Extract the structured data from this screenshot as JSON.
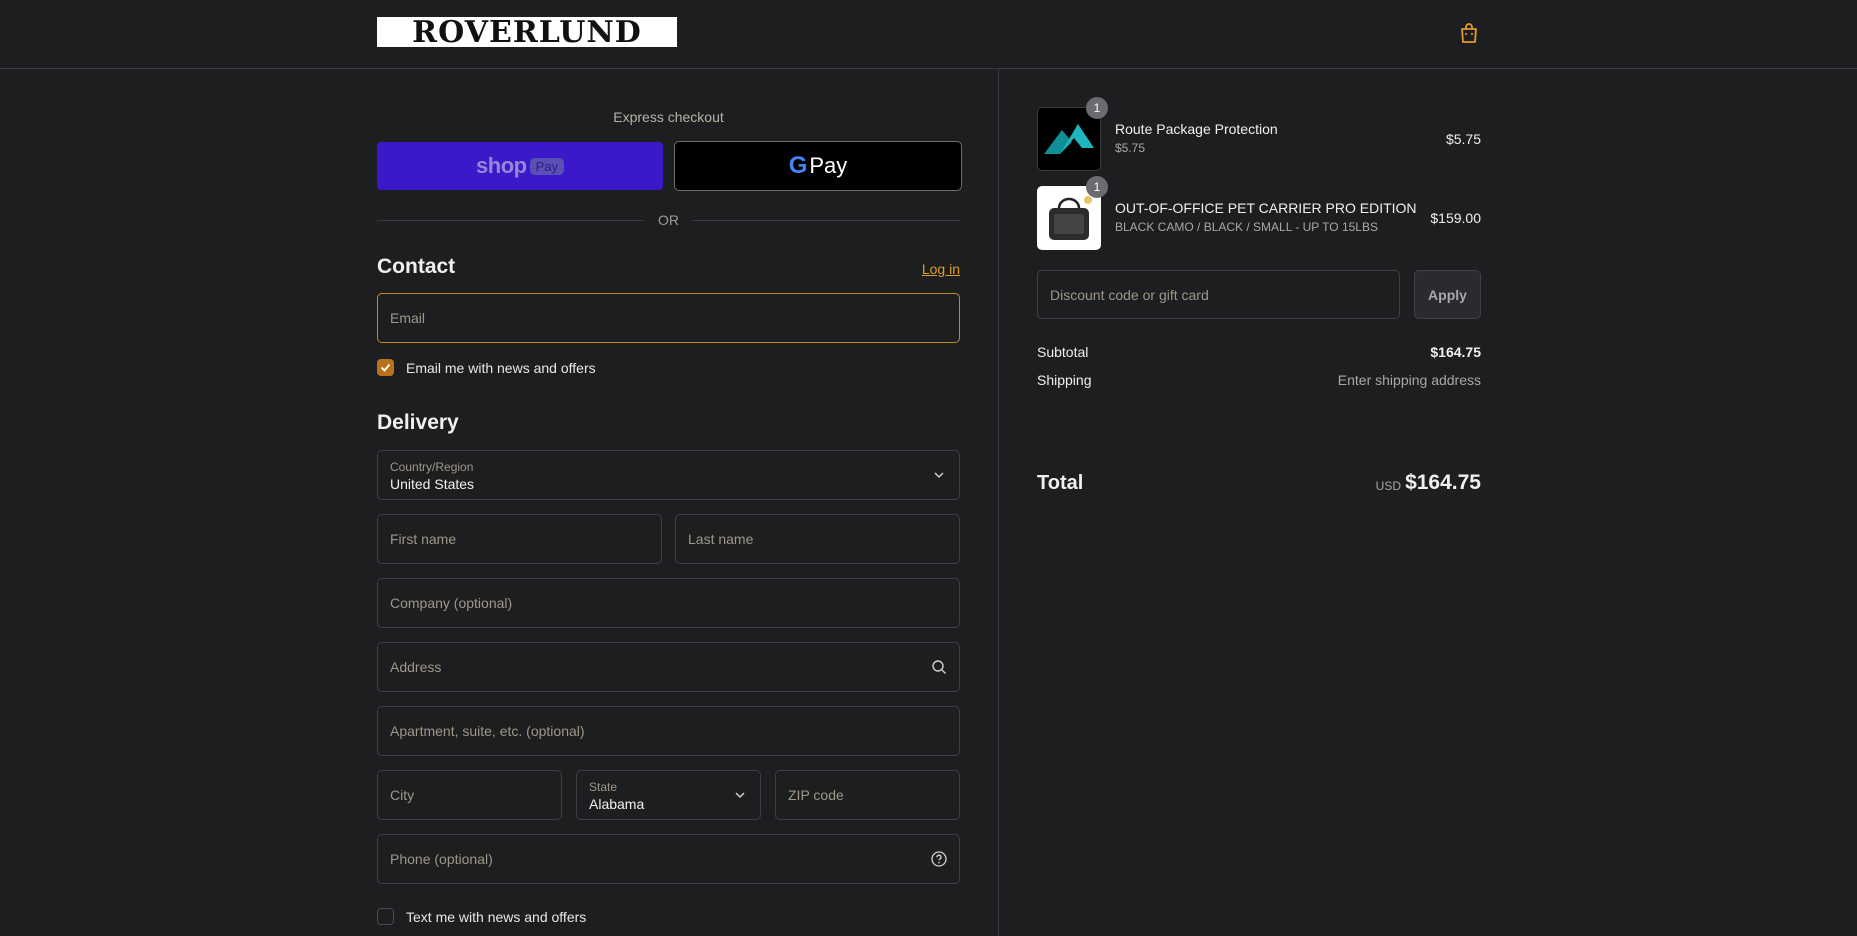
{
  "brand": {
    "logo_text": "ROVERLUND"
  },
  "header": {
    "cart_icon": "shopping-bag-icon"
  },
  "express": {
    "title": "Express checkout",
    "shop_pay_label": "shop",
    "shop_pay_pill": "Pay",
    "gpay_g": "G",
    "gpay_label": "Pay",
    "or_label": "OR"
  },
  "contact": {
    "heading": "Contact",
    "login_label": "Log in",
    "email_placeholder": "Email",
    "news_label": "Email me with news and offers",
    "news_checked": true
  },
  "delivery": {
    "heading": "Delivery",
    "country_label": "Country/Region",
    "country_value": "United States",
    "first_name_placeholder": "First name",
    "last_name_placeholder": "Last name",
    "company_placeholder": "Company (optional)",
    "address_placeholder": "Address",
    "apartment_placeholder": "Apartment, suite, etc. (optional)",
    "city_placeholder": "City",
    "state_label": "State",
    "state_value": "Alabama",
    "zip_placeholder": "ZIP code",
    "phone_placeholder": "Phone (optional)",
    "text_label": "Text me with news and offers",
    "text_checked": false
  },
  "cart": {
    "items": [
      {
        "name": "Route Package Protection",
        "subtitle": "$5.75",
        "price": "$5.75",
        "quantity": "1",
        "image": "route-logo"
      },
      {
        "name": "OUT-OF-OFFICE PET CARRIER PRO EDITION",
        "subtitle": "BLACK CAMO / BLACK / SMALL - UP TO 15LBS",
        "price": "$159.00",
        "quantity": "1",
        "image": "pet-carrier-bag"
      }
    ],
    "discount_placeholder": "Discount code or gift card",
    "apply_label": "Apply"
  },
  "summary": {
    "subtotal_label": "Subtotal",
    "subtotal_value": "$164.75",
    "shipping_label": "Shipping",
    "shipping_value": "Enter shipping address",
    "total_label": "Total",
    "currency": "USD",
    "total_value": "$164.75"
  },
  "colors": {
    "background": "#1d1e20",
    "accent": "#e39b2b",
    "shop_pay": "#3b18c8"
  }
}
